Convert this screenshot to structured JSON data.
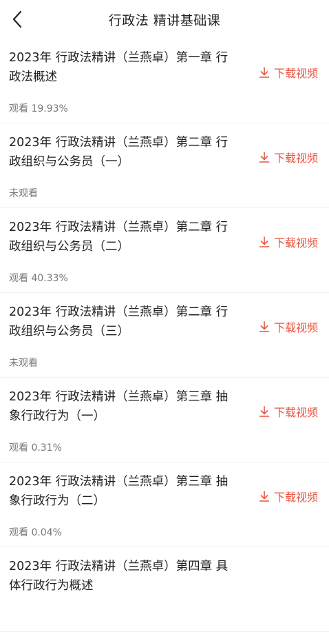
{
  "header": {
    "title": "行政法  精讲基础课"
  },
  "icons": {
    "back": "chevron-left-icon",
    "download": "download-arrow-icon"
  },
  "colors": {
    "accent": "#e8533f"
  },
  "list": {
    "items": [
      {
        "title": "2023年 行政法精讲（兰燕卓）第一章 行政法概述",
        "status": "观看 19.93%",
        "action": "下载视频"
      },
      {
        "title": "2023年 行政法精讲（兰燕卓）第二章 行政组织与公务员（一）",
        "status": "未观看",
        "action": "下载视频"
      },
      {
        "title": "2023年 行政法精讲（兰燕卓）第二章 行政组织与公务员（二）",
        "status": "观看 40.33%",
        "action": "下载视频"
      },
      {
        "title": "2023年 行政法精讲（兰燕卓）第二章 行政组织与公务员（三）",
        "status": "未观看",
        "action": "下载视频"
      },
      {
        "title": "2023年 行政法精讲（兰燕卓）第三章 抽象行政行为（一）",
        "status": "观看 0.31%",
        "action": "下载视频"
      },
      {
        "title": "2023年 行政法精讲（兰燕卓）第三章 抽象行政行为（二）",
        "status": "观看 0.04%",
        "action": "下载视频"
      },
      {
        "title": "2023年 行政法精讲（兰燕卓）第四章 具体行政行为概述",
        "status": "",
        "action": ""
      }
    ]
  }
}
